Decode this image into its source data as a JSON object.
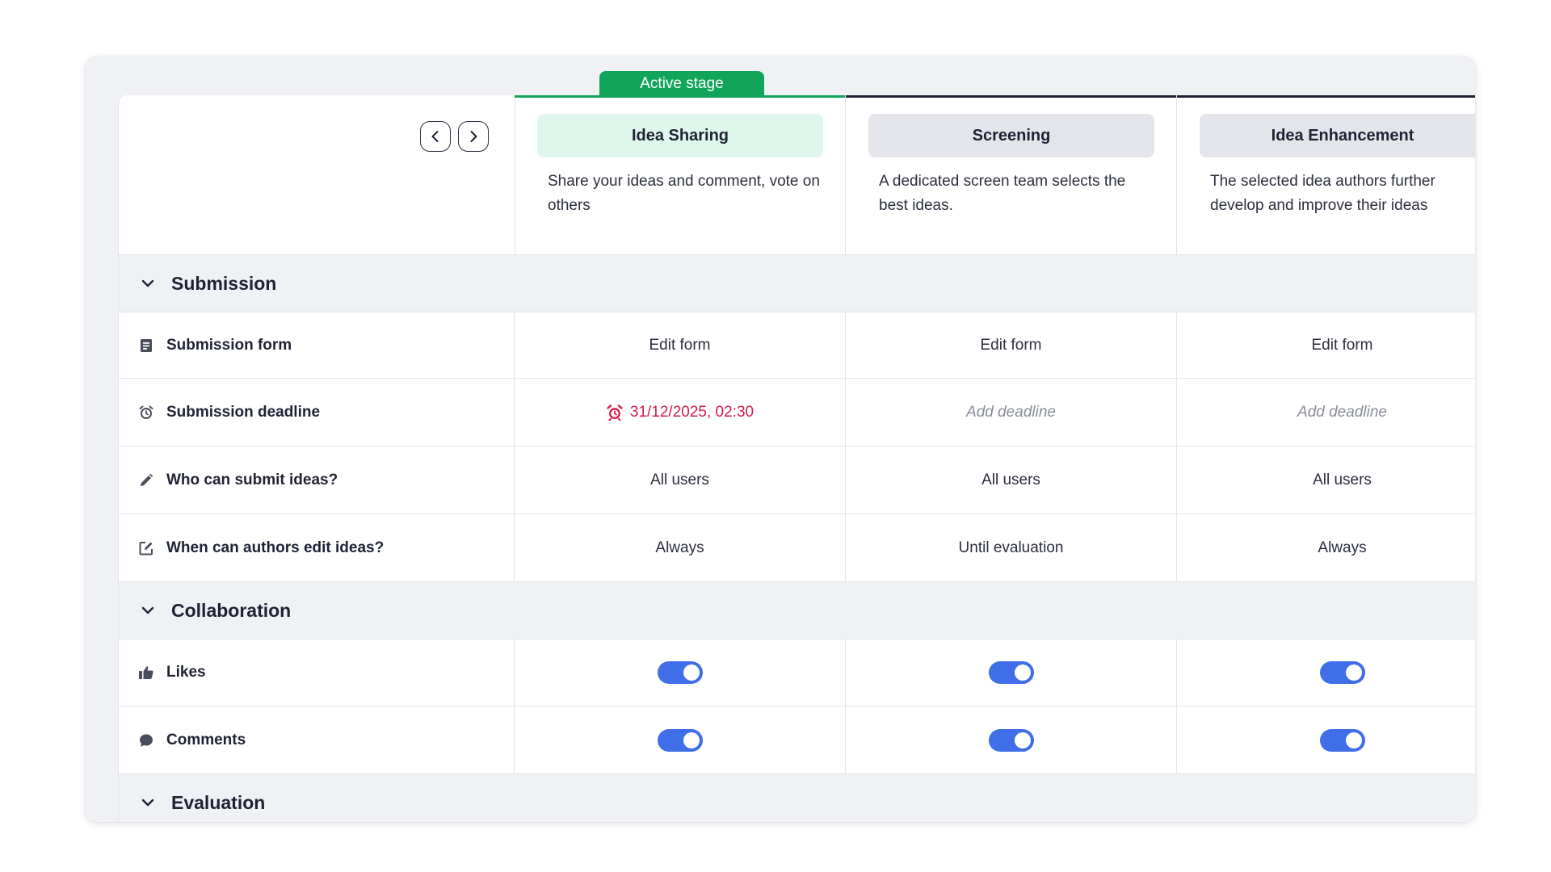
{
  "active_stage_label": "Active stage",
  "stages": [
    {
      "name": "Idea Sharing",
      "description": "Share your ideas and comment, vote on others",
      "active": true
    },
    {
      "name": "Screening",
      "description": "A dedicated screen team selects the best ideas.",
      "active": false
    },
    {
      "name": "Idea Enhancement",
      "description": "The selected idea authors further develop and improve their ideas",
      "active": false
    }
  ],
  "sections": {
    "submission": {
      "title": "Submission",
      "rows": {
        "form": {
          "label": "Submission form",
          "values": [
            "Edit form",
            "Edit form",
            "Edit form"
          ]
        },
        "deadline": {
          "label": "Submission deadline",
          "values": [
            "31/12/2025, 02:30",
            "Add deadline",
            "Add deadline"
          ]
        },
        "who": {
          "label": "Who can submit ideas?",
          "values": [
            "All users",
            "All users",
            "All users"
          ]
        },
        "edit": {
          "label": "When can authors edit ideas?",
          "values": [
            "Always",
            "Until evaluation",
            "Always"
          ]
        }
      }
    },
    "collaboration": {
      "title": "Collaboration",
      "rows": {
        "likes": {
          "label": "Likes",
          "values": [
            true,
            true,
            true
          ]
        },
        "comments": {
          "label": "Comments",
          "values": [
            true,
            true,
            true
          ]
        }
      }
    },
    "evaluation": {
      "title": "Evaluation"
    }
  },
  "icons": {
    "nav_prev": "chevron-left-icon",
    "nav_next": "chevron-right-icon",
    "section_toggle": "chevron-down-icon",
    "form": "document-icon",
    "deadline": "alarm-clock-icon",
    "who": "pencil-icon",
    "edit": "edit-square-icon",
    "likes": "thumbs-up-icon",
    "comments": "speech-bubble-icon"
  },
  "colors": {
    "active_green": "#11a55a",
    "active_pill_bg": "#dff6ec",
    "toggle_on": "#3f6ee8",
    "deadline_red": "#d81b4a",
    "placeholder_gray": "#8a8d99"
  }
}
